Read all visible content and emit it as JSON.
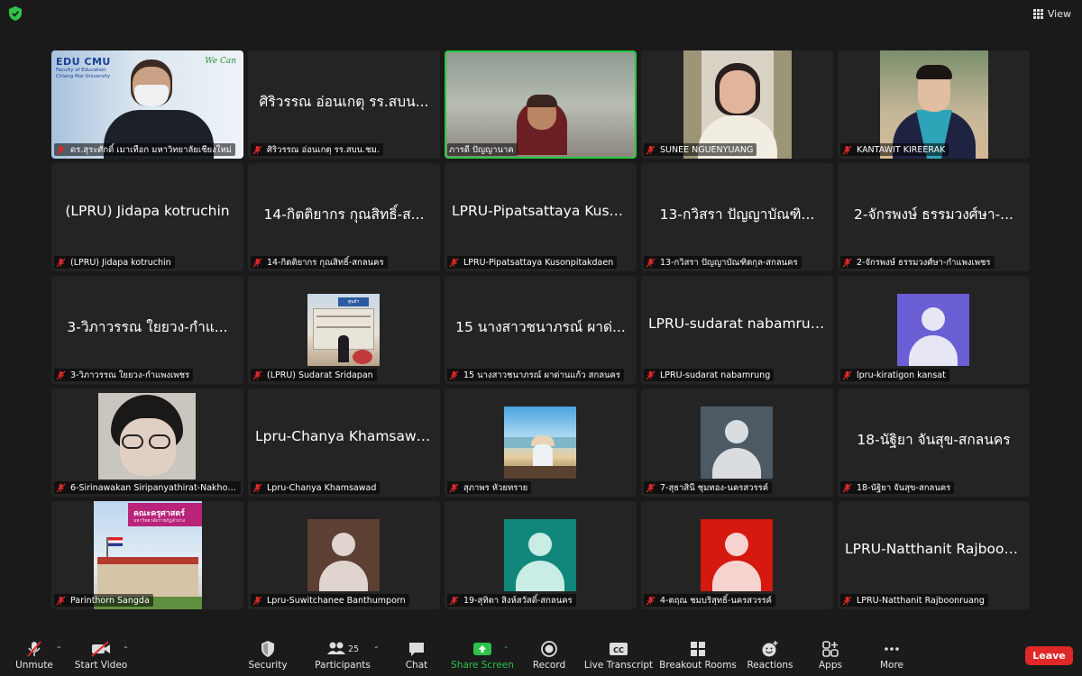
{
  "topbar": {
    "view_label": "View",
    "security_icon": "shield-check-icon"
  },
  "tiles": [
    {
      "name": "ดร.สุระศักดิ์ เมาเทือก มหาวิทยาลัยเชียงใหม่",
      "big": ""
    },
    {
      "name": "ศิริวรรณ อ่อนเกตุ รร.สบน.ชม.",
      "big": "ศิริวรรณ อ่อนเกตุ รร.สบน..."
    },
    {
      "name": "ภารดี ปัญญานาค",
      "big": ""
    },
    {
      "name": "SUNEE NGUENYUANG",
      "big": ""
    },
    {
      "name": "KANTAWIT KIREERAK",
      "big": ""
    },
    {
      "name": "(LPRU) Jidapa kotruchin",
      "big": "(LPRU) Jidapa kotruchin"
    },
    {
      "name": "14-กิตติยากร กุณสิทธิ์-สกลนคร",
      "big": "14-กิตติยากร กุณสิทธิ์-ส..."
    },
    {
      "name": "LPRU-Pipatsattaya Kusonpitakdaen",
      "big": "LPRU-Pipatsattaya Kuso..."
    },
    {
      "name": "13-กวิสรา ปัญญาบัณฑิตกุล-สกลนคร",
      "big": "13-กวิสรา ปัญญาบัณฑิ..."
    },
    {
      "name": "2-จักรพงษ์ ธรรมวงศ์ษา-กำแพงเพชร",
      "big": "2-จักรพงษ์ ธรรมวงศ์ษา-..."
    },
    {
      "name": "3-วิภาวรรณ ใยยวง-กำแพงเพชร",
      "big": "3-วิภาวรรณ ใยยวง-กำแ..."
    },
    {
      "name": "(LPRU) Sudarat Sridapan",
      "big": ""
    },
    {
      "name": "15 นางสาวชนาภรณ์ ผาด่านแก้ว สกลนคร",
      "big": "15 นางสาวชนาภรณ์ ผาด่..."
    },
    {
      "name": "LPRU-sudarat nabamrung",
      "big": "LPRU-sudarat nabamrung"
    },
    {
      "name": "lpru-kiratigon kansat",
      "big": ""
    },
    {
      "name": "6-Sirinawakan Siripanyathirat-Nakhon...",
      "big": ""
    },
    {
      "name": "Lpru-Chanya Khamsawad",
      "big": "Lpru-Chanya Khamsawad"
    },
    {
      "name": "สุภาพร หัวยทราย",
      "big": ""
    },
    {
      "name": "7-สุธาสินี ชุมทอง-นครสวรรค์",
      "big": ""
    },
    {
      "name": "18-นัฐิยา จันสุข-สกลนคร",
      "big": "18-นัฐิยา จันสุข-สกลนคร"
    },
    {
      "name": "Parinthorn Sangda",
      "big": ""
    },
    {
      "name": "Lpru-Suwitchanee Banthumporn",
      "big": ""
    },
    {
      "name": "19-สุทิตา สิงห์สวัสดิ์-สกลนคร",
      "big": ""
    },
    {
      "name": "4-ตฤณ ชมบริสุทธิ์-นครสวรรค์",
      "big": ""
    },
    {
      "name": "LPRU-Natthanit Rajboonruang",
      "big": "LPRU-Natthanit Rajboon..."
    }
  ],
  "pictures": {
    "t0_brand": "EDU CMU",
    "t0_sub1": "Faculty of Education",
    "t0_sub2": "Chiang Mai University",
    "t0_tag": "We Can",
    "t11_sign": "ศูนย์ฯ",
    "t20_banner": "คณะครุศาสตร์",
    "t20_sub": "มหาวิทยาลัยราชภัฏลำปาง"
  },
  "avatar_colors": {
    "kiratigon": "#6a5fd4",
    "sutasinee": "#4e5a63",
    "suwitchanee": "#5c4034",
    "sutita": "#10877a",
    "trin": "#d5190f"
  },
  "toolbar": {
    "unmute": "Unmute",
    "start_video": "Start Video",
    "security": "Security",
    "participants": "Participants",
    "participants_count": "25",
    "chat": "Chat",
    "share_screen": "Share Screen",
    "record": "Record",
    "live_transcript": "Live Transcript",
    "breakout_rooms": "Breakout Rooms",
    "reactions": "Reactions",
    "apps": "Apps",
    "more": "More",
    "leave": "Leave"
  },
  "colors": {
    "share_green": "#2fc24a",
    "leave_red": "#e02828",
    "active_speaker": "#27c93f"
  }
}
